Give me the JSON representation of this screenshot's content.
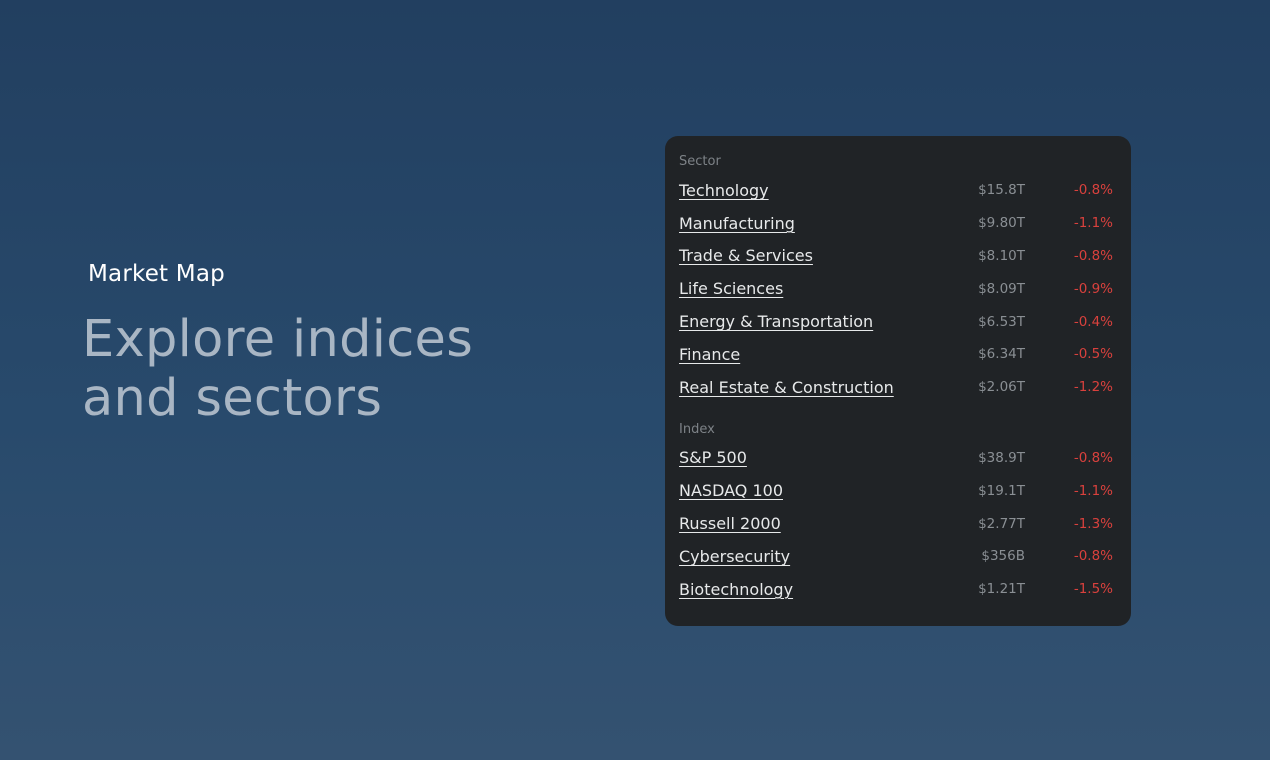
{
  "hero": {
    "eyebrow": "Market Map",
    "headline_line1": "Explore indices",
    "headline_line2": "and sectors"
  },
  "panel": {
    "sector_label": "Sector",
    "index_label": "Index",
    "sectors": [
      {
        "name": "Technology",
        "cap": "$15.8T",
        "change": "-0.8%"
      },
      {
        "name": "Manufacturing",
        "cap": "$9.80T",
        "change": "-1.1%"
      },
      {
        "name": "Trade & Services",
        "cap": "$8.10T",
        "change": "-0.8%"
      },
      {
        "name": "Life Sciences",
        "cap": "$8.09T",
        "change": "-0.9%"
      },
      {
        "name": "Energy & Transportation",
        "cap": "$6.53T",
        "change": "-0.4%"
      },
      {
        "name": "Finance",
        "cap": "$6.34T",
        "change": "-0.5%"
      },
      {
        "name": "Real Estate & Construction",
        "cap": "$2.06T",
        "change": "-1.2%"
      }
    ],
    "indices": [
      {
        "name": "S&P 500",
        "cap": "$38.9T",
        "change": "-0.8%"
      },
      {
        "name": "NASDAQ 100",
        "cap": "$19.1T",
        "change": "-1.1%"
      },
      {
        "name": "Russell 2000",
        "cap": "$2.77T",
        "change": "-1.3%"
      },
      {
        "name": "Cybersecurity",
        "cap": "$356B",
        "change": "-0.8%"
      },
      {
        "name": "Biotechnology",
        "cap": "$1.21T",
        "change": "-1.5%"
      }
    ]
  },
  "colors": {
    "background_top": "#223f60",
    "background_bottom": "#345271",
    "panel": "#202326",
    "negative_change": "#d9413d",
    "headline": "#a9b6c4"
  }
}
